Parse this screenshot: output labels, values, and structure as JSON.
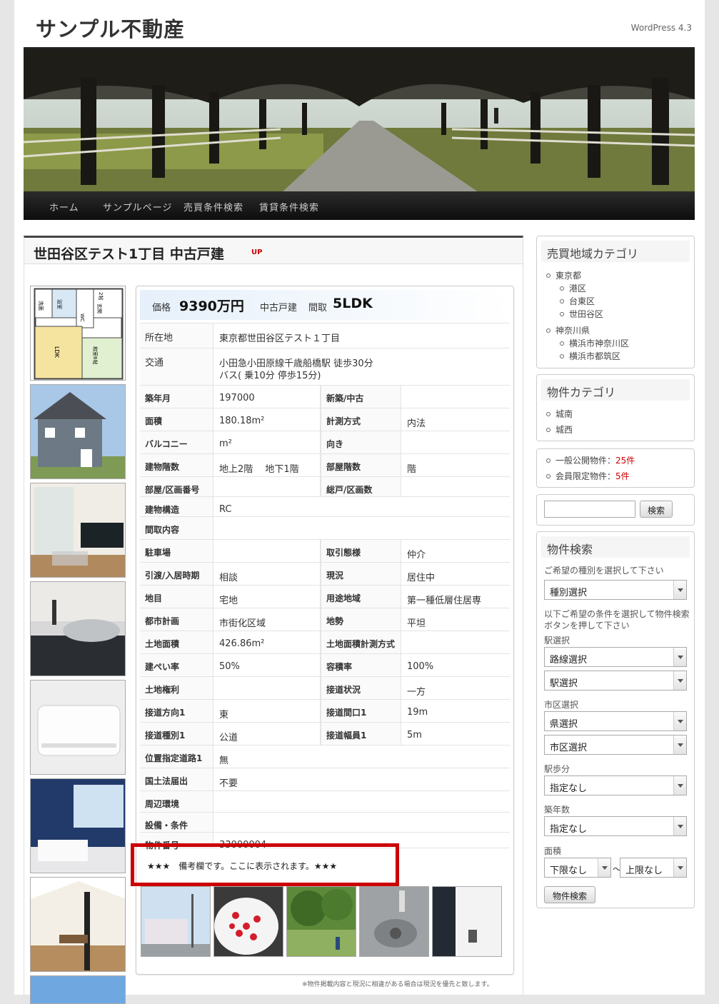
{
  "site": {
    "title": "サンプル不動産",
    "version": "WordPress 4.3"
  },
  "nav": {
    "items": [
      "ホーム",
      "サンプルページ",
      "売買条件検索",
      "賃貸条件検索"
    ]
  },
  "property": {
    "title": "世田谷区テスト1丁目 中古戸建",
    "badge": "UP",
    "price_label": "価格",
    "price_value": "9390万円",
    "type": "中古戸建",
    "madori_label": "間取",
    "madori_value": "5LDK"
  },
  "specs": {
    "location": {
      "label": "所在地",
      "value": "東京都世田谷区テスト１丁目"
    },
    "access": {
      "label": "交通",
      "line1": "小田急小田原線千歳船橋駅 徒歩30分",
      "line2": "バス( 乗10分 停歩15分)"
    },
    "rows": [
      {
        "l1": "築年月",
        "v1": "197000",
        "l2": "新築/中古",
        "v2": ""
      },
      {
        "l1": "面積",
        "v1": "180.18m²",
        "l2": "計測方式",
        "v2": "内法"
      },
      {
        "l1": "バルコニー",
        "v1": "m²",
        "l2": "向き",
        "v2": ""
      },
      {
        "l1": "建物階数",
        "v1": "地上2階　 地下1階",
        "l2": "部屋階数",
        "v2": "階"
      },
      {
        "l1": "部屋/区画番号",
        "v1": "",
        "l2": "総戸/区画数",
        "v2": ""
      },
      {
        "l1": "建物構造",
        "v1": "RC"
      },
      {
        "l1": "間取内容",
        "v1": ""
      },
      {
        "l1": "駐車場",
        "v1": "",
        "l2": "取引態様",
        "v2": "仲介"
      },
      {
        "l1": "引渡/入居時期",
        "v1": "相談",
        "l2": "現況",
        "v2": "居住中"
      },
      {
        "l1": "地目",
        "v1": "宅地",
        "l2": "用途地域",
        "v2": "第一種低層住居専"
      },
      {
        "l1": "都市計画",
        "v1": "市街化区域",
        "l2": "地勢",
        "v2": "平坦"
      },
      {
        "l1": "土地面積",
        "v1": "426.86m²",
        "l2": "土地面積計測方式",
        "v2": ""
      },
      {
        "l1": "建ぺい率",
        "v1": "50%",
        "l2": "容積率",
        "v2": "100%"
      },
      {
        "l1": "土地権利",
        "v1": "",
        "l2": "接道状況",
        "v2": "一方"
      },
      {
        "l1": "接道方向1",
        "v1": "東",
        "l2": "接道間口1",
        "v2": "19m"
      },
      {
        "l1": "接道種別1",
        "v1": "公道",
        "l2": "接道幅員1",
        "v2": "5m"
      },
      {
        "l1": "位置指定道路1",
        "v1": "無"
      },
      {
        "l1": "国土法届出",
        "v1": "不要"
      },
      {
        "l1": "周辺環境",
        "v1": ""
      },
      {
        "l1": "設備・条件",
        "v1": ""
      },
      {
        "l1": "物件番号",
        "v1": "33000004"
      }
    ],
    "remarks": "★★★　備考欄です。ここに表示されます。★★★",
    "notice": "※物件掲載内容と現況に相違がある場合は現況を優先と致します。"
  },
  "floorplan_labels": [
    "洗面",
    "浴室",
    "WC",
    "玄関",
    "和室6帖",
    "LDK",
    "2帖"
  ],
  "sidebar": {
    "area_title": "売買地域カテゴリ",
    "areas": [
      {
        "name": "東京都",
        "children": [
          "港区",
          "台東区",
          "世田谷区"
        ]
      },
      {
        "name": "神奈川県",
        "children": [
          "横浜市神奈川区",
          "横浜市都筑区"
        ]
      }
    ],
    "cat_title": "物件カテゴリ",
    "cats": [
      "城南",
      "城西"
    ],
    "counts": [
      {
        "label": "一般公開物件：",
        "value": "25件"
      },
      {
        "label": "会員限定物件：",
        "value": "5件"
      }
    ],
    "search_button": "検索",
    "search_title": "物件検索",
    "prompt1": "ご希望の種別を選択して下さい",
    "type_select": "種別選択",
    "prompt2": "以下ご希望の条件を選択して物件検索ボタンを押して下さい",
    "station_label": "駅選択",
    "route_select": "路線選択",
    "station_select": "駅選択",
    "city_label": "市区選択",
    "pref_select": "県選択",
    "city_select": "市区選択",
    "walk_label": "駅歩分",
    "walk_select": "指定なし",
    "age_label": "築年数",
    "age_select": "指定なし",
    "area_label": "面積",
    "area_min": "下限なし",
    "tilde": "〜",
    "area_max": "上限なし",
    "submit": "物件検索"
  }
}
